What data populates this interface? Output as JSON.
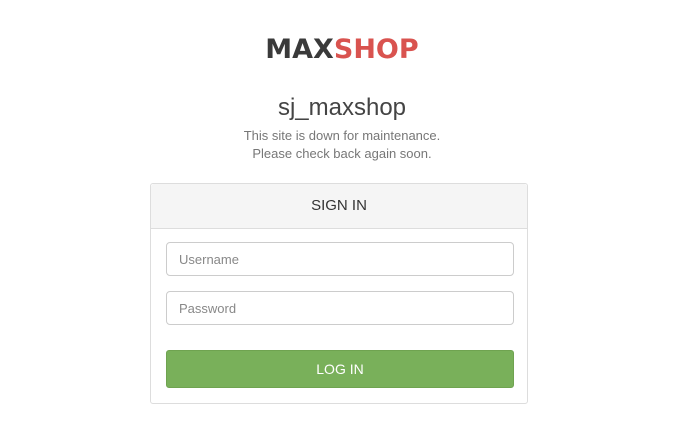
{
  "logo": {
    "part1": "MAX",
    "part2": "SHOP",
    "colors": {
      "part1": "#3a3a3a",
      "part2": "#d9534f"
    }
  },
  "site": {
    "title": "sj_maxshop",
    "maintenance_line1": "This site is down for maintenance.",
    "maintenance_line2": "Please check back again soon."
  },
  "signin": {
    "heading": "SIGN IN",
    "username_placeholder": "Username",
    "username_value": "",
    "password_placeholder": "Password",
    "password_value": "",
    "login_label": "LOG IN",
    "button_color": "#79b05a"
  }
}
